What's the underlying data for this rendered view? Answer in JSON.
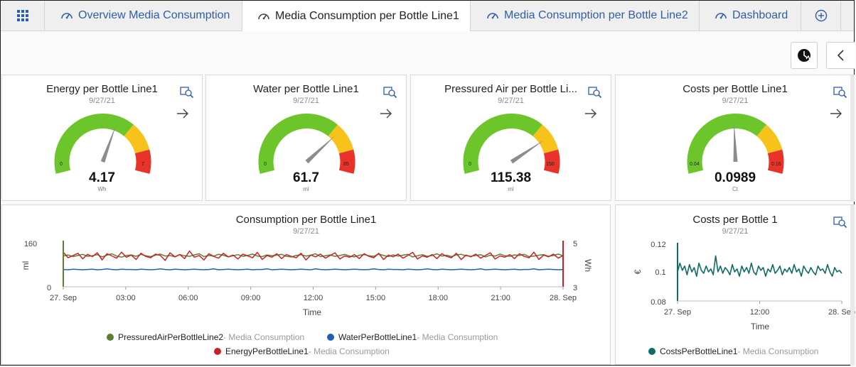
{
  "tabs": [
    {
      "label": "Overview Media Consumption",
      "active": false
    },
    {
      "label": "Media Consumption per Bottle Line1",
      "active": true
    },
    {
      "label": "Media Consumption per Bottle Line2",
      "active": false
    },
    {
      "label": "Dashboard",
      "active": false
    }
  ],
  "toolbar": {
    "icons": [
      "time-icon",
      "chevron-left-icon"
    ]
  },
  "gauges": [
    {
      "title": "Energy per Bottle Line1",
      "date": "9/27/21",
      "value": "4.17",
      "unit": "Wh",
      "min": "0",
      "max": "7",
      "fraction": 0.595
    },
    {
      "title": "Water per Bottle Line1",
      "date": "9/27/21",
      "value": "61.7",
      "unit": "ml",
      "min": "0",
      "max": "85",
      "fraction": 0.726
    },
    {
      "title": "Pressured Air per Bottle Li...",
      "date": "9/27/21",
      "value": "115.38",
      "unit": "ml",
      "min": "0",
      "max": "150",
      "fraction": 0.769
    },
    {
      "title": "Costs per Bottle Line1",
      "date": "9/27/21",
      "value": "0.0989",
      "unit": "Ct",
      "min": "0.04",
      "max": "0.16",
      "fraction": 0.49
    }
  ],
  "consumption_chart": {
    "title": "Consumption per Bottle Line1",
    "date": "9/27/21",
    "xlabel": "Time",
    "y_left_label": "ml",
    "y_right_label": "Wh",
    "y_left_ticks": [
      "160",
      "0"
    ],
    "y_right_ticks": [
      "5",
      "3"
    ],
    "x_ticks": [
      "27. Sep",
      "03:00",
      "06:00",
      "09:00",
      "12:00",
      "15:00",
      "18:00",
      "21:00",
      "28. Sep"
    ],
    "legend": [
      {
        "name": "PressuredAirPerBottleLine2",
        "source": " - Media Consumption",
        "color": "#5b7f2e"
      },
      {
        "name": "WaterPerBottleLine1",
        "source": " - Media Consumption",
        "color": "#1f5fb4"
      },
      {
        "name": "EnergyPerBottleLine1",
        "source": " - Media Consumption",
        "color": "#cc1f2e"
      }
    ]
  },
  "costs_chart": {
    "title": "Costs per Bottle 1",
    "date": "9/27/21",
    "xlabel": "Time",
    "ylabel": "€",
    "y_ticks": [
      "0.12",
      "0.1",
      "0.08"
    ],
    "x_ticks": [
      "27. Sep",
      "12:00",
      "28. Sep"
    ],
    "legend": [
      {
        "name": "CostsPerBottleLine1",
        "source": " - Media Consumption",
        "color": "#0f6b66"
      }
    ]
  },
  "chart_data": [
    {
      "type": "line",
      "title": "Consumption per Bottle Line1",
      "xlabel": "Time",
      "ylabel": "ml",
      "x_range": [
        "27. Sep 00:00",
        "28. Sep 00:00"
      ],
      "ylim": [
        0,
        160
      ],
      "y2lim": [
        3,
        5
      ],
      "series": [
        {
          "name": "PressuredAirPerBottleLine2",
          "axis": "left",
          "values": [
            110,
            114,
            108,
            112,
            116,
            109,
            111,
            115,
            107,
            113,
            118,
            110,
            106,
            112,
            114,
            109,
            116,
            111,
            108,
            113,
            117,
            110,
            112,
            107,
            115,
            111,
            109,
            114,
            118,
            108,
            112,
            110,
            116,
            113,
            107,
            111,
            115,
            109,
            112,
            117,
            110,
            108,
            114,
            111,
            113,
            116,
            109,
            107,
            112,
            115,
            110,
            113,
            118,
            108,
            111,
            114,
            109,
            112,
            116,
            110,
            107,
            113,
            115,
            111,
            109,
            117,
            112,
            108,
            114,
            110,
            113,
            116,
            107,
            111,
            115,
            109,
            112,
            118,
            110,
            113,
            108,
            114,
            116,
            111,
            109,
            112,
            115,
            107,
            113,
            110,
            117,
            111,
            109,
            114,
            112,
            116,
            108,
            110,
            113,
            115,
            109,
            112,
            117,
            111
          ]
        },
        {
          "name": "WaterPerBottleLine1",
          "axis": "left",
          "values": [
            62,
            61,
            63,
            62,
            61,
            62,
            63,
            61,
            62,
            64,
            62,
            61,
            63,
            62,
            62,
            61,
            63,
            62,
            61,
            62,
            64,
            62,
            61,
            63,
            62,
            61,
            62,
            63,
            62,
            61,
            62,
            64,
            61,
            62,
            63,
            62,
            61,
            62,
            63,
            61,
            62,
            62,
            64,
            61,
            62,
            63,
            62,
            61,
            62,
            63,
            62,
            61,
            64,
            62,
            61,
            62,
            63,
            62,
            61,
            62,
            63,
            62,
            61,
            62,
            64,
            62,
            61,
            63,
            62,
            62,
            61,
            63,
            62,
            61,
            62,
            64,
            62,
            61,
            63,
            62,
            61,
            62,
            63,
            62,
            61,
            62,
            64,
            61,
            62,
            63,
            62,
            61,
            62,
            63,
            61,
            62,
            62,
            64,
            61,
            62,
            63,
            62,
            61,
            62
          ]
        },
        {
          "name": "EnergyPerBottleLine1",
          "axis": "right",
          "values": [
            4.55,
            4.3,
            4.4,
            4.5,
            4.25,
            4.45,
            4.35,
            4.52,
            4.2,
            4.48,
            4.38,
            4.28,
            4.55,
            4.32,
            4.42,
            4.22,
            4.5,
            4.36,
            4.3,
            4.46,
            4.4,
            4.18,
            4.52,
            4.34,
            4.44,
            4.26,
            4.6,
            4.32,
            4.4,
            4.2,
            4.48,
            4.36,
            4.28,
            4.5,
            4.34,
            4.42,
            4.24,
            4.46,
            4.38,
            4.3,
            4.54,
            4.22,
            4.4,
            4.32,
            4.48,
            4.26,
            4.44,
            4.36,
            4.3,
            4.5,
            4.2,
            4.42,
            4.34,
            4.46,
            4.28,
            4.4,
            4.52,
            4.24,
            4.38,
            4.32,
            4.44,
            4.26,
            4.48,
            4.36,
            4.3,
            4.5,
            4.22,
            4.42,
            4.34,
            4.46,
            4.28,
            4.4,
            4.54,
            4.24,
            4.38,
            4.32,
            4.44,
            4.26,
            4.48,
            4.36,
            4.3,
            4.5,
            4.22,
            4.42,
            4.34,
            4.46,
            4.28,
            4.4,
            4.52,
            4.24,
            4.38,
            4.32,
            4.44,
            4.26,
            4.48,
            4.36,
            4.3,
            4.55,
            4.22,
            4.42,
            4.34,
            4.46,
            4.28,
            4.4
          ]
        }
      ]
    },
    {
      "type": "line",
      "title": "Costs per Bottle 1",
      "xlabel": "Time",
      "ylabel": "€",
      "x_range": [
        "27. Sep 00:00",
        "28. Sep 00:00"
      ],
      "ylim": [
        0.08,
        0.12
      ],
      "series": [
        {
          "name": "CostsPerBottleLine1",
          "values": [
            0.1,
            0.106,
            0.101,
            0.104,
            0.098,
            0.105,
            0.1,
            0.103,
            0.097,
            0.106,
            0.101,
            0.099,
            0.104,
            0.1,
            0.102,
            0.098,
            0.111,
            0.1,
            0.104,
            0.099,
            0.103,
            0.101,
            0.098,
            0.105,
            0.1,
            0.102,
            0.097,
            0.104,
            0.1,
            0.103,
            0.099,
            0.106,
            0.1,
            0.098,
            0.104,
            0.101,
            0.103,
            0.097,
            0.102,
            0.1,
            0.105,
            0.099,
            0.101,
            0.104,
            0.098,
            0.102,
            0.1,
            0.103,
            0.099,
            0.105,
            0.1,
            0.102,
            0.097,
            0.104,
            0.101,
            0.099,
            0.103,
            0.1,
            0.098,
            0.104,
            0.101,
            0.102,
            0.099,
            0.105,
            0.1,
            0.097,
            0.103,
            0.1,
            0.101,
            0.099
          ]
        }
      ]
    }
  ]
}
